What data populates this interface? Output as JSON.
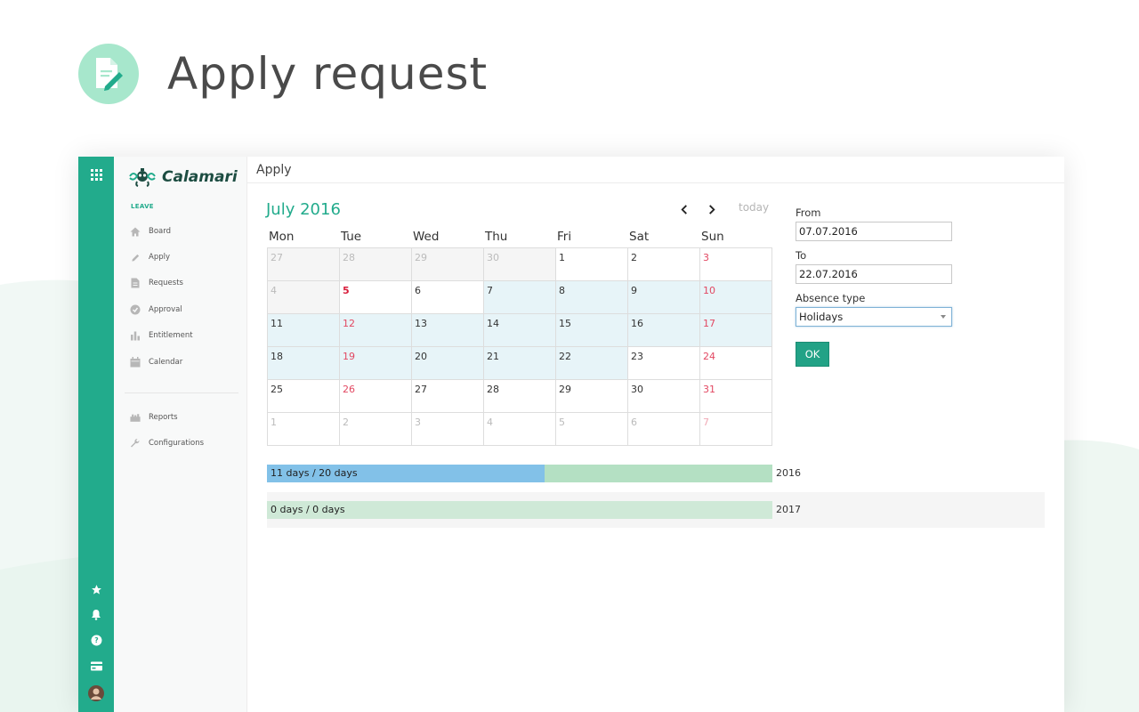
{
  "hero": {
    "title": "Apply request",
    "icon": "document-edit-icon"
  },
  "colors": {
    "accent": "#22ab8c",
    "rail": "#22ab8c",
    "weekend": "#e24862",
    "holiday": "#d81e3c",
    "selected": "#e7f4f8",
    "bar_used": "#82c1e8",
    "bar_remaining": "#b4e0c3",
    "ok_button": "#22a286"
  },
  "rail": {
    "top_icon": "apps-grid-icon",
    "bottom_icons": [
      "star-icon",
      "bell-icon",
      "help-icon",
      "billing-card-icon",
      "user-avatar"
    ]
  },
  "sidebar": {
    "logo_text": "Calamari",
    "section_label": "LEAVE",
    "items": [
      {
        "label": "Board",
        "icon": "home-icon"
      },
      {
        "label": "Apply",
        "icon": "pencil-icon"
      },
      {
        "label": "Requests",
        "icon": "document-icon"
      },
      {
        "label": "Approval",
        "icon": "check-circle-icon"
      },
      {
        "label": "Entitlement",
        "icon": "bar-chart-icon"
      },
      {
        "label": "Calendar",
        "icon": "calendar-icon"
      }
    ],
    "secondary_items": [
      {
        "label": "Reports",
        "icon": "reports-icon"
      },
      {
        "label": "Configurations",
        "icon": "wrench-icon"
      }
    ]
  },
  "page": {
    "title": "Apply"
  },
  "calendar": {
    "month_title": "July 2016",
    "prev_label": "‹",
    "next_label": "›",
    "today_label": "today",
    "weekdays": [
      "Mon",
      "Tue",
      "Wed",
      "Thu",
      "Fri",
      "Sat",
      "Sun"
    ],
    "weeks": [
      [
        "27",
        "28",
        "29",
        "30",
        "1",
        "2",
        "3"
      ],
      [
        "4",
        "5",
        "6",
        "7",
        "8",
        "9",
        "10"
      ],
      [
        "11",
        "12",
        "13",
        "14",
        "15",
        "16",
        "17"
      ],
      [
        "18",
        "19",
        "20",
        "21",
        "22",
        "23",
        "24"
      ],
      [
        "25",
        "26",
        "27",
        "28",
        "29",
        "30",
        "31"
      ],
      [
        "1",
        "2",
        "3",
        "4",
        "5",
        "6",
        "7"
      ]
    ],
    "holiday": "5"
  },
  "form": {
    "from_label": "From",
    "from_value": "07.07.2016",
    "to_label": "To",
    "to_value": "22.07.2016",
    "absence_label": "Absence type",
    "absence_value": "Holidays",
    "ok_label": "OK"
  },
  "balances": [
    {
      "text": "11 days / 20 days",
      "year": "2016",
      "used": 11,
      "total": 20
    },
    {
      "text": "0 days / 0 days",
      "year": "2017",
      "used": 0,
      "total": 0
    }
  ]
}
